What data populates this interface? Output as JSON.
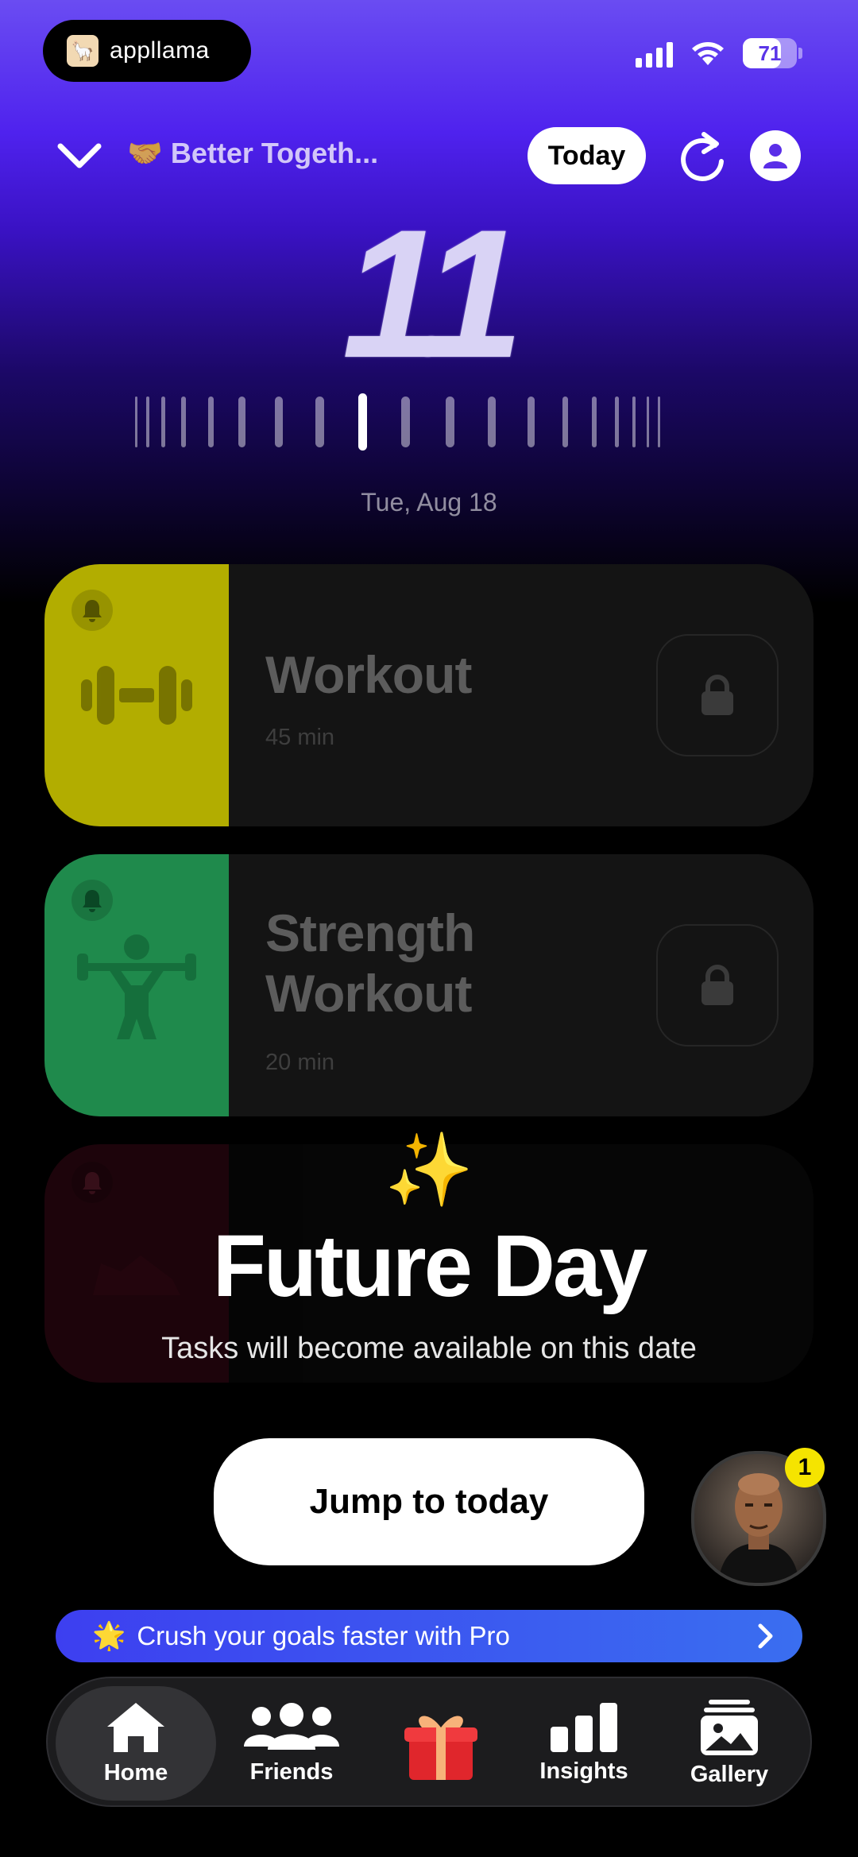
{
  "status_bar": {
    "brand_name": "appllama",
    "battery_level": "71"
  },
  "header": {
    "group_title": "🤝 Better Togeth...",
    "today_label": "Today"
  },
  "day_picker": {
    "day_number": "11",
    "date_label": "Tue, Aug 18"
  },
  "tasks": [
    {
      "title": "Workout",
      "duration": "45 min",
      "color": "#b2ad00",
      "icon": "dumbbell-icon"
    },
    {
      "title": "Strength Workout",
      "title_line1": "Strength",
      "title_line2": "Workout",
      "duration": "20 min",
      "color": "#1f8a4c",
      "icon": "weightlifter-icon"
    },
    {
      "title": "",
      "duration": "",
      "color": "#6a0f22",
      "icon": "shoe-icon"
    }
  ],
  "future_overlay": {
    "sparkles": "✨",
    "title": "Future Day",
    "subtitle": "Tasks will become available on this date",
    "jump_label": "Jump to today"
  },
  "coach": {
    "badge_count": "1"
  },
  "promo": {
    "star": "🌟",
    "text": "Crush your goals faster with Pro"
  },
  "tabbar": {
    "home": "Home",
    "friends": "Friends",
    "insights": "Insights",
    "gallery": "Gallery"
  }
}
